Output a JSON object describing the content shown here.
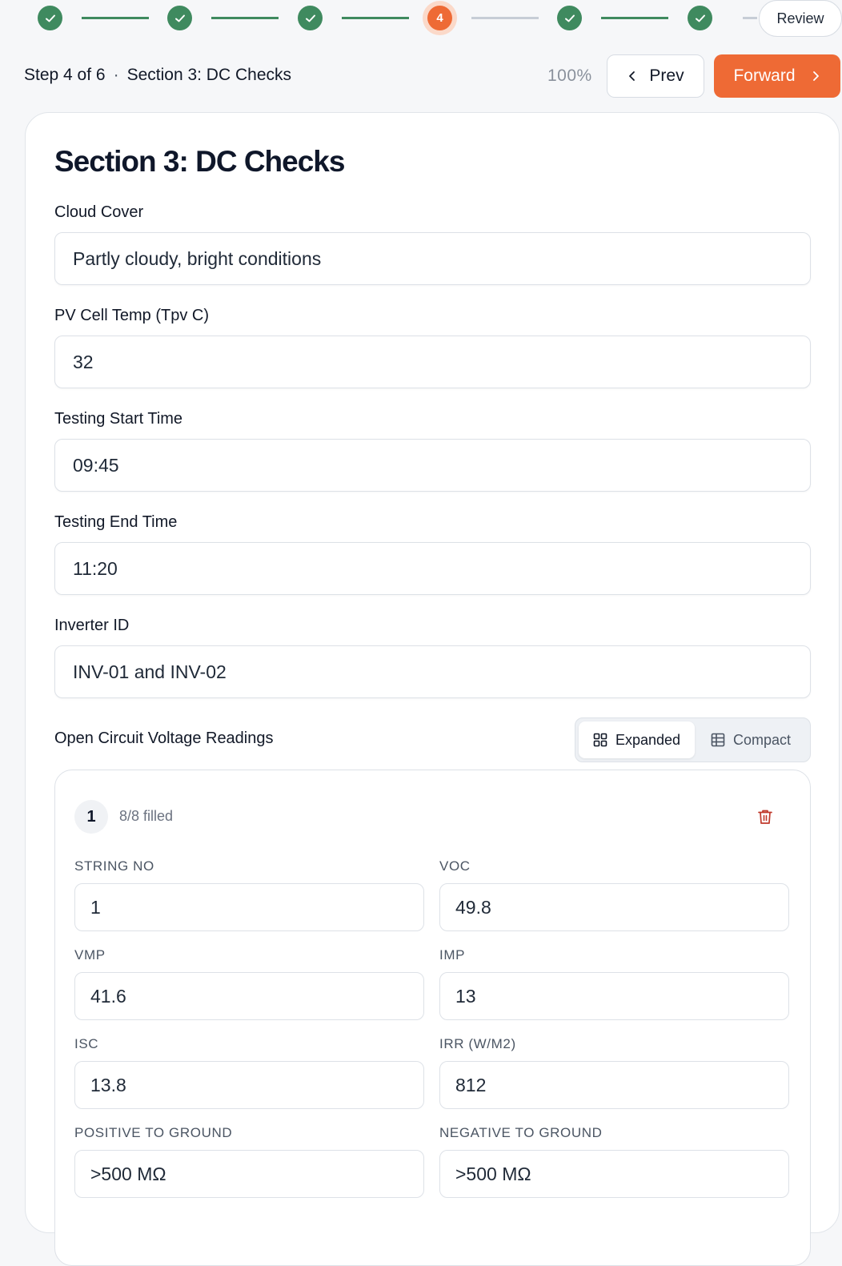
{
  "stepper": {
    "current_step_number": "4",
    "review_label": "Review",
    "steps": [
      "done",
      "done",
      "done",
      "current",
      "done",
      "done"
    ]
  },
  "header": {
    "step_text": "Step 4 of 6",
    "separator": "·",
    "section_text": "Section 3: DC Checks",
    "progress": "100%",
    "prev_label": "Prev",
    "forward_label": "Forward"
  },
  "form": {
    "title": "Section 3: DC Checks",
    "fields": [
      {
        "label": "Cloud Cover",
        "value": "Partly cloudy, bright conditions"
      },
      {
        "label": "PV Cell Temp (Tpv C)",
        "value": "32"
      },
      {
        "label": "Testing Start Time",
        "value": "09:45"
      },
      {
        "label": "Testing End Time",
        "value": "11:20"
      },
      {
        "label": "Inverter ID",
        "value": "INV-01 and INV-02"
      }
    ],
    "ocv": {
      "label": "Open Circuit Voltage Readings",
      "toggle_expanded": "Expanded",
      "toggle_compact": "Compact",
      "readings": [
        {
          "number": "1",
          "filled": "8/8 filled",
          "string_no_label": "STRING NO",
          "string_no": "1",
          "voc_label": "VOC",
          "voc": "49.8",
          "vmp_label": "VMP",
          "vmp": "41.6",
          "imp_label": "IMP",
          "imp": "13",
          "isc_label": "ISC",
          "isc": "13.8",
          "irr_label": "IRR (W/M2)",
          "irr": "812",
          "pos_ground_label": "POSITIVE TO GROUND",
          "pos_ground": ">500 MΩ",
          "neg_ground_label": "NEGATIVE TO GROUND",
          "neg_ground": ">500 MΩ"
        }
      ]
    }
  },
  "colors": {
    "done": "#3f8a5f",
    "current": "#ee6a35",
    "accent": "#ee6a35",
    "delete": "#c0392b"
  }
}
